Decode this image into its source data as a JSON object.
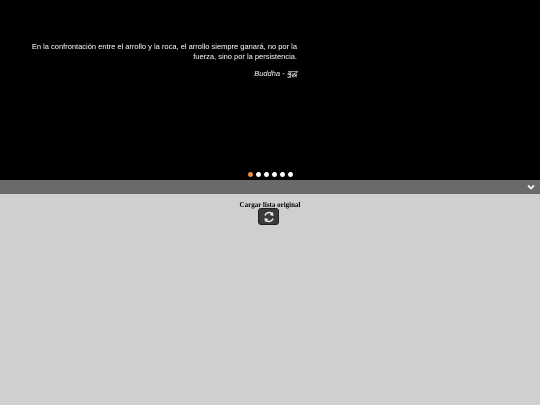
{
  "slider": {
    "quote": "En la confrontación entre el arrollo y la roca, el arrollo siempre ganará, no por la fuerza, sino por la persistencia.",
    "author": "Buddha - बुद्ध",
    "dots": [
      {
        "active": true
      },
      {
        "active": false
      },
      {
        "active": false
      },
      {
        "active": false
      },
      {
        "active": false
      },
      {
        "active": false
      }
    ]
  },
  "bar": {
    "icon": "chevron-down-icon"
  },
  "reload": {
    "label": "Cargar lista original",
    "icon": "refresh-icon"
  },
  "colors": {
    "slider_bg": "#000000",
    "bar_bg": "#6a6a6a",
    "content_bg": "#cfcfcf",
    "active_dot": "#f28c38"
  }
}
